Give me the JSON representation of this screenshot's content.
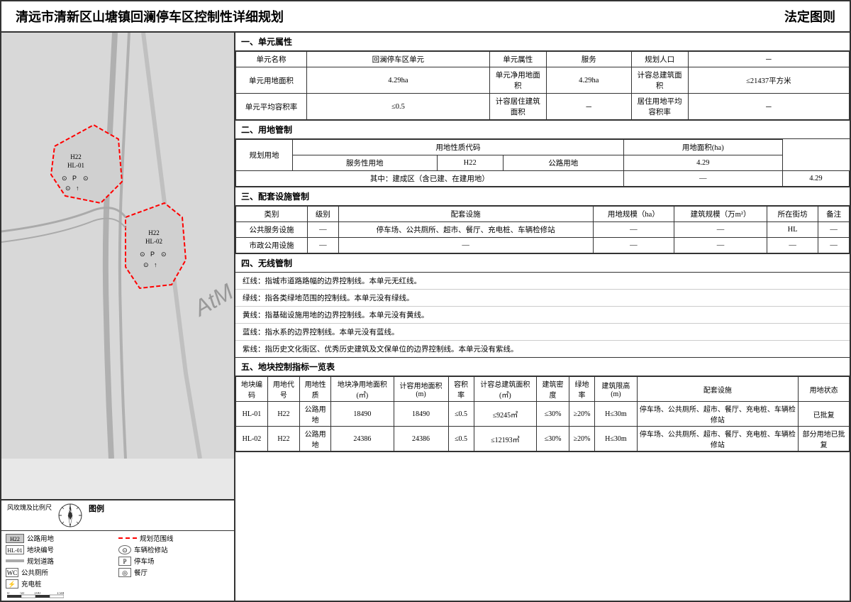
{
  "header": {
    "title": "清远市清新区山塘镇回澜停车区控制性详细规划",
    "right": "法定图则"
  },
  "section1": {
    "title": "一、单元属性",
    "rows": [
      {
        "cols": [
          {
            "label": "单元名称",
            "value": "回澜停车区单元"
          },
          {
            "label": "单元属性",
            "value": "服务"
          },
          {
            "label": "规划人口",
            "value": "－"
          }
        ]
      },
      {
        "cols": [
          {
            "label": "单元用地面积",
            "value": "4.29ha"
          },
          {
            "label": "单元净用地面积",
            "value": "4.29ha"
          },
          {
            "label": "计容总建筑面积",
            "value": "≤21437平方米"
          }
        ]
      },
      {
        "cols": [
          {
            "label": "单元平均容积率",
            "value": "≤0.5"
          },
          {
            "label": "计容居住建筑面积",
            "value": "－"
          },
          {
            "label": "居住用地平均容积率",
            "value": "－"
          }
        ]
      }
    ]
  },
  "section2": {
    "title": "二、用地管制",
    "header_row1": [
      "规划用地",
      "用地性质代码",
      "",
      "",
      "用地面积(ha)"
    ],
    "header_row2": [
      "服务性用地",
      "H22",
      "公路用地",
      "4.29"
    ],
    "data_row": [
      "其中：建成区（含已建、在建用地）",
      "—",
      "4.29"
    ]
  },
  "section3": {
    "title": "三、配套设施管制",
    "headers": [
      "类别",
      "级别",
      "配套设施",
      "用地规模（ha）",
      "建筑规模（万m²）",
      "所在街坊",
      "备注"
    ],
    "rows": [
      {
        "type": "公共服务设施",
        "level": "—",
        "facility": "停车场、公共厕所、超市、餐厅、充电桩、车辆检修站",
        "land_scale": "—",
        "build_scale": "—",
        "street": "HL",
        "note": "—"
      },
      {
        "type": "市政公用设施",
        "level": "—",
        "facility": "—",
        "land_scale": "—",
        "build_scale": "—",
        "street": "—",
        "note": "—"
      }
    ]
  },
  "section4": {
    "title": "四、无线管制",
    "lines": [
      "红线：指城市道路路幅的边界控制线。本单元无红线。",
      "绿线：指各类绿地范围的控制线。本单元没有绿线。",
      "黄线：指基础设施用地的边界控制线。本单元没有黄线。",
      "蓝线：指水系的边界控制线。本单元没有蓝线。",
      "紫线：指历史文化街区、优秀历史建筑及文保单位的边界控制线。本单元没有紫线。"
    ]
  },
  "section5": {
    "title": "五、地块控制指标一览表",
    "headers": [
      "地块编码",
      "用地代号",
      "用地性质",
      "地块净用地面积(㎡)",
      "计容用地面积(m)",
      "容积率",
      "计容总建筑面积(㎡)",
      "建筑密度",
      "绿地率",
      "建筑限高(m)",
      "配套设施",
      "用地状态"
    ],
    "rows": [
      {
        "code": "HL-01",
        "use_code": "H22",
        "use_type": "公路用地",
        "net_area": "18490",
        "cap_area": "18490",
        "far": "≤0.5",
        "total_build": "≤9245㎡",
        "density": "≤30%",
        "green": "≥20%",
        "height": "H≤30m",
        "facilities": "停车场、公共厕所、超市、餐厅、充电桩、车辆检修站",
        "status": "已批复"
      },
      {
        "code": "HL-02",
        "use_code": "H22",
        "use_type": "公路用地",
        "net_area": "24386",
        "cap_area": "24386",
        "far": "≤0.5",
        "total_build": "≤12193㎡",
        "density": "≤30%",
        "green": "≥20%",
        "height": "H≤30m",
        "facilities": "停车场、公共厕所、超市、餐厅、充电桩、车辆检修站",
        "status": "部分用地已批复"
      }
    ]
  },
  "legend": {
    "title": "图例",
    "wind_rose": "风玫瑰及比例尺",
    "items": [
      {
        "symbol": "H22",
        "label": "公路用地"
      },
      {
        "symbol": "- - -",
        "label": "规划范围线"
      },
      {
        "symbol": "WC",
        "label": "公共厕所"
      },
      {
        "symbol": "HL-01",
        "label": "地块编号"
      },
      {
        "symbol": "⊙",
        "label": "车辆检修站"
      },
      {
        "symbol": "P",
        "label": "停车场"
      },
      {
        "symbol": "═══",
        "label": "规划道路"
      },
      {
        "symbol": "◎",
        "label": "餐厅"
      },
      {
        "symbol": "⚡",
        "label": "充电桩"
      }
    ],
    "scale": "0  50  100   150m"
  },
  "map": {
    "block_hl01": {
      "label": "H22\nHL-01",
      "icons": [
        "⊙P⊙",
        "⊙↑"
      ]
    },
    "block_hl02": {
      "label": "H22\nHL-02",
      "icons": [
        "⊙P⊙",
        "⊙↑"
      ]
    },
    "atm_label": "AtM"
  }
}
